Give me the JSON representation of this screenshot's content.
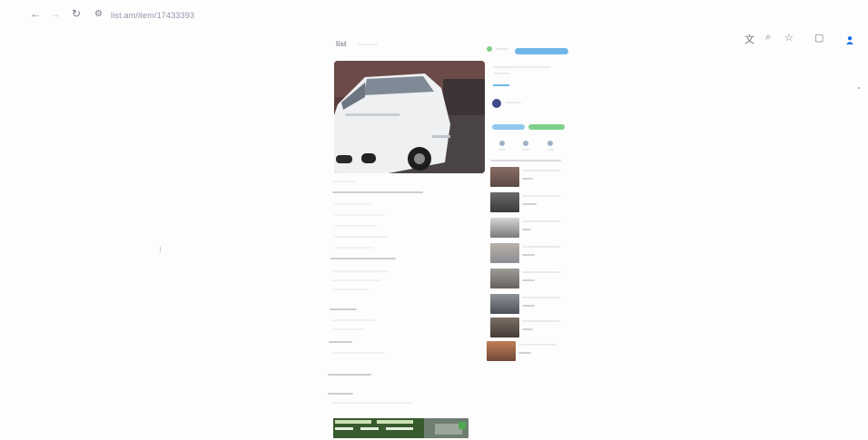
{
  "browser": {
    "back_icon": "arrow-left-icon",
    "forward_icon": "arrow-right-icon",
    "reload_icon": "reload-icon",
    "site_info_icon": "site-settings-icon",
    "url": "list.am/item/17433393",
    "toolbar_icons": [
      "translate-icon",
      "zoom-icon",
      "bookmark-star-icon",
      "extensions-icon",
      "profile-icon"
    ]
  },
  "site": {
    "logo": "list",
    "header_button": "",
    "accent": "#6fb8e8",
    "green": "#7fd08a"
  },
  "listing": {
    "title": "",
    "price": "",
    "seller_name": "",
    "description_heading": "",
    "sections": [],
    "footer_banner": ""
  },
  "contact": {
    "call_button": "",
    "message_button": ""
  },
  "related": {
    "heading": "",
    "items": [
      {
        "title": "",
        "price": ""
      },
      {
        "title": "",
        "price": ""
      },
      {
        "title": "",
        "price": ""
      },
      {
        "title": "",
        "price": ""
      },
      {
        "title": "",
        "price": ""
      },
      {
        "title": "",
        "price": ""
      },
      {
        "title": "",
        "price": ""
      },
      {
        "title": "",
        "price": ""
      }
    ]
  }
}
